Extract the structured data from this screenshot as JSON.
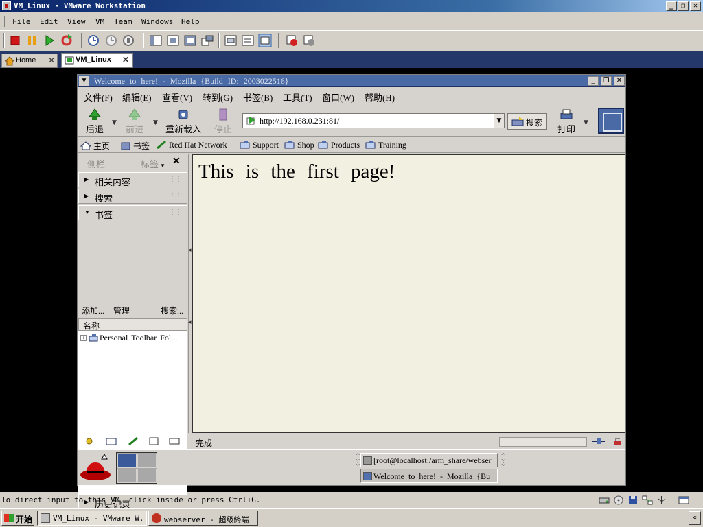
{
  "host": {
    "title": "VM_Linux - VMware Workstation",
    "menu": [
      "File",
      "Edit",
      "View",
      "VM",
      "Team",
      "Windows",
      "Help"
    ],
    "tabs": [
      {
        "label": "Home",
        "active": false
      },
      {
        "label": "VM_Linux",
        "active": true
      }
    ],
    "status_message": "To direct input to this VM, click inside or press Ctrl+G."
  },
  "guest_browser": {
    "title": "Welcome to here! - Mozilla {Build ID: 2003022516}",
    "menu": [
      "文件(F)",
      "编辑(E)",
      "查看(V)",
      "转到(G)",
      "书签(B)",
      "工具(T)",
      "窗口(W)",
      "帮助(H)"
    ],
    "nav": {
      "back": "后退",
      "forward": "前进",
      "reload": "重新载入",
      "stop": "停止",
      "search": "搜索",
      "print": "打印"
    },
    "url": "http://192.168.0.231:81/",
    "personal_toolbar": [
      "主页",
      "书签",
      "Red Hat Network",
      "Support",
      "Shop",
      "Products",
      "Training"
    ],
    "sidebar": {
      "header_title": "侧栏",
      "tabs_label": "标签",
      "sections": [
        "相关内容",
        "搜索",
        "书签"
      ],
      "tools": [
        "添加...",
        "管理",
        "搜索..."
      ],
      "column": "名称",
      "tree_item": "Personal Toolbar Fol...",
      "history_section": "历史记录"
    },
    "page_heading": "This is the first page!",
    "status_text": "完成"
  },
  "guest_panel": {
    "tasks": [
      {
        "label": "[root@localhost:/arm_share/webser",
        "pressed": false
      },
      {
        "label": "Welcome to here! - Mozilla {Bu",
        "pressed": true
      }
    ]
  },
  "taskbar": {
    "start": "开始",
    "tasks": [
      {
        "label": "VM_Linux - VMware W...",
        "pressed": true
      },
      {
        "label": "webserver - 超级終端",
        "pressed": false
      }
    ]
  },
  "colors": {
    "vm_background": "#000000",
    "page_background": "#f2f0e0",
    "mozilla_title_bar": "#4a6aa5"
  }
}
